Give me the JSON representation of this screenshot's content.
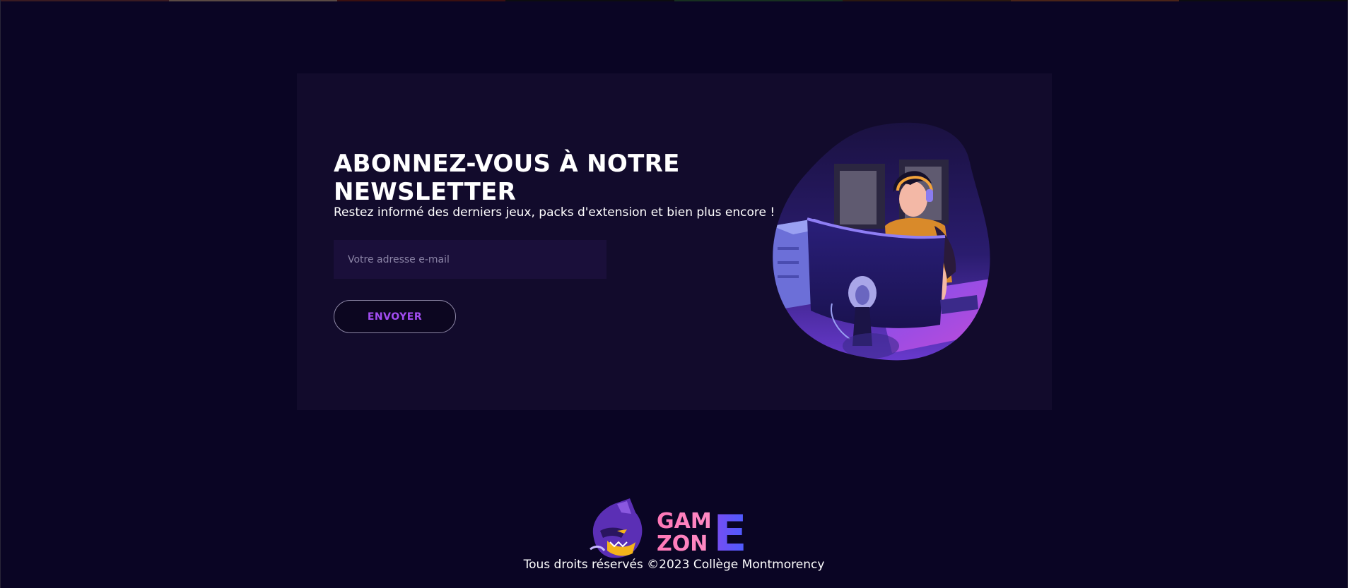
{
  "newsletter": {
    "title": "ABONNEZ-VOUS À NOTRE NEWSLETTER",
    "subtitle": "Restez informé des derniers jeux, packs d'extension et bien plus encore !",
    "email_placeholder": "Votre adresse e-mail",
    "email_value": "",
    "submit_label": "ENVOYER",
    "illustration": "gamer-at-computer-illustration"
  },
  "footer": {
    "logo_text_line1": "GAM",
    "logo_text_line2": "ZON",
    "logo_text_big_letter": "E",
    "logo_mascot": "wolf-mascot-icon",
    "copyright": "Tous droits réservés ©2023 Collège Montmorency"
  },
  "colors": {
    "page_background": "#0a0524",
    "card_background": "#120b2c",
    "input_background": "#1a0f3a",
    "button_text": "#a34df2",
    "logo_pink": "#ff77b7",
    "logo_blue": "#4a5cff"
  }
}
